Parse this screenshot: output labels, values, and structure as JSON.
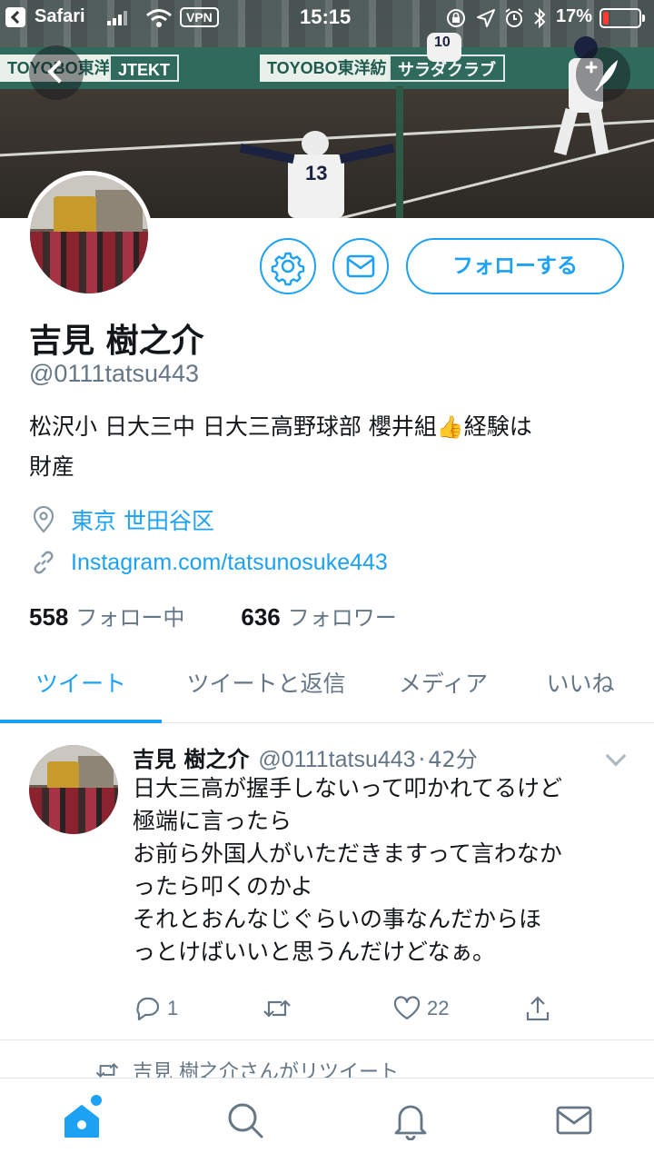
{
  "status_bar": {
    "app": "Safari",
    "vpn": "VPN",
    "time": "15:15",
    "battery": "17%",
    "battery_level": 0.17
  },
  "profile": {
    "follow_button": "フォローする",
    "display_name": "吉見 樹之介",
    "handle": "@0111tatsu443",
    "bio_line1_a": "松沢小 日大三中 日大三高野球部 櫻井組",
    "bio_emoji": "👍",
    "bio_line1_b": "経験は",
    "bio_line2": "財産",
    "location": "東京 世田谷区",
    "website": "Instagram.com/tatsunosuke443",
    "following_count": "558",
    "following_label": "フォロー中",
    "followers_count": "636",
    "followers_label": "フォロワー"
  },
  "tabs": [
    {
      "label": "ツイート",
      "active": true
    },
    {
      "label": "ツイートと返信",
      "active": false
    },
    {
      "label": "メディア",
      "active": false
    },
    {
      "label": "いいね",
      "active": false
    }
  ],
  "tweet": {
    "name": "吉見 樹之介",
    "handle": "@0111tatsu443",
    "separator": "·",
    "time_ago": "42分",
    "lines": [
      "日大三高が握手しないって叩かれてるけど",
      "極端に言ったら",
      "お前ら外国人がいただきますって言わなか",
      "ったら叩くのかよ",
      "それとおんなじぐらいの事なんだからほ",
      "っとけばいいと思うんだけどなぁ。"
    ],
    "reply_count": "1",
    "retweet_count": "",
    "like_count": "22"
  },
  "retweet_note": "吉見 樹之介さんがリツイート",
  "banner": {
    "player_number": "13",
    "batter_number": "10",
    "ads": [
      "TOYOBO東洋紡",
      "JTEKT",
      "サラダクラブ",
      "TOYOBO東洋紡"
    ]
  },
  "colors": {
    "accent": "#1da1f2",
    "text_primary": "#14171a",
    "text_secondary": "#657786"
  }
}
